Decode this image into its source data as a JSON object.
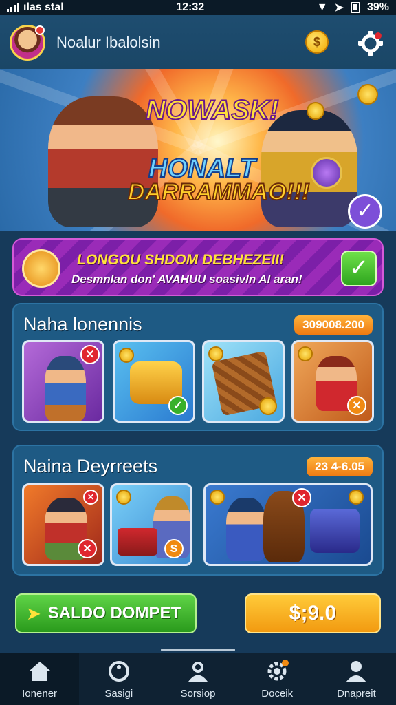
{
  "status_bar": {
    "carrier": "ılas stal",
    "time": "12:32",
    "battery": "39%"
  },
  "header": {
    "username": "Noalur Ibalolsin",
    "coin_symbol": "$"
  },
  "banner": {
    "title": "NOWASK!",
    "line2": "HONALT",
    "line3": "DARRAMMAO!!!"
  },
  "promo": {
    "title": "LONGOU SHDOM DEBHEZEII!",
    "subtitle": "Desmnlan don' AVAHUU soasivln Al aran!"
  },
  "sections": [
    {
      "title": "Naha lonennis",
      "pill": "309008.200"
    },
    {
      "title": "Naina Deyrreets",
      "pill": "23 4-6.05"
    }
  ],
  "buttons": {
    "wallet_label": "SALDO DOMPET",
    "amount": "$;9.0"
  },
  "nav": [
    {
      "label": "Ionener",
      "icon": "home-icon"
    },
    {
      "label": "Sasigi",
      "icon": "search-icon"
    },
    {
      "label": "Sorsiop",
      "icon": "shop-icon"
    },
    {
      "label": "Doceik",
      "icon": "gear-icon"
    },
    {
      "label": "Dnapreit",
      "icon": "profile-icon"
    }
  ],
  "colors": {
    "accent_green": "#38b02a",
    "accent_orange": "#f29a10",
    "background": "#163a5a"
  }
}
